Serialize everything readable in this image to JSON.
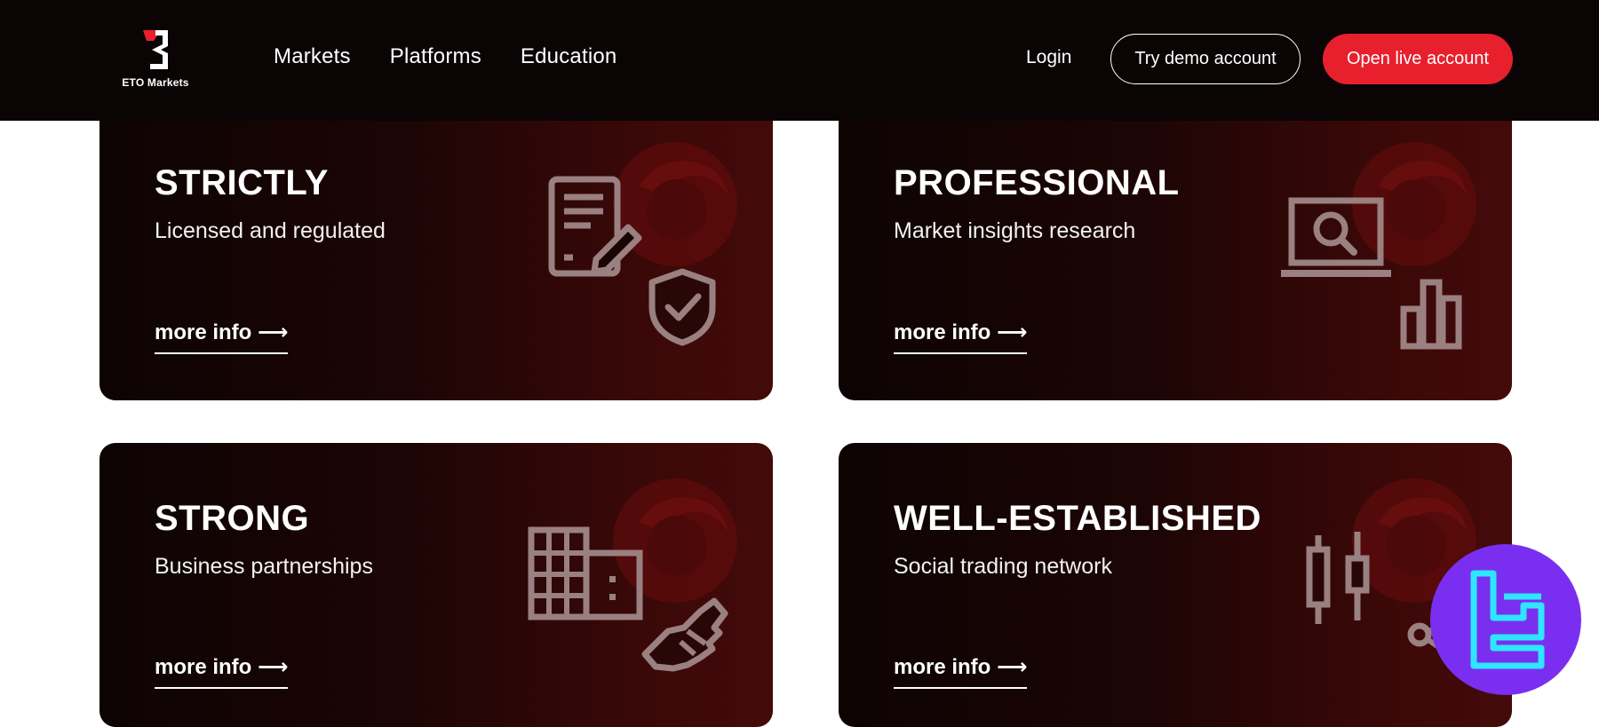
{
  "header": {
    "logo_text": "ETO Markets",
    "nav": [
      "Markets",
      "Platforms",
      "Education"
    ],
    "login_label": "Login",
    "demo_button_label": "Try demo account",
    "live_button_label": "Open live account"
  },
  "cards": [
    {
      "title": "STRICTLY",
      "subtitle": "Licensed and regulated",
      "link": "more info ⟶",
      "icons": [
        "document-edit-icon",
        "shield-check-icon"
      ]
    },
    {
      "title": "PROFESSIONAL",
      "subtitle": "Market insights research",
      "link": "more info ⟶",
      "icons": [
        "laptop-search-icon",
        "bar-chart-icon"
      ]
    },
    {
      "title": "STRONG",
      "subtitle": "Business partnerships",
      "link": "more info ⟶",
      "icons": [
        "building-icon",
        "handshake-icon"
      ]
    },
    {
      "title": "WELL-ESTABLISHED",
      "subtitle": "Social trading network",
      "link": "more info ⟶",
      "icons": [
        "candlestick-icon",
        "share-network-icon"
      ]
    }
  ],
  "colors": {
    "header_bg": "#0a0404",
    "accent_red": "#e8202d",
    "card_dark": "#0d0303",
    "card_red": "#440a0a",
    "badge_purple": "#7a2ff0",
    "badge_cyan": "#2ee6ff"
  }
}
